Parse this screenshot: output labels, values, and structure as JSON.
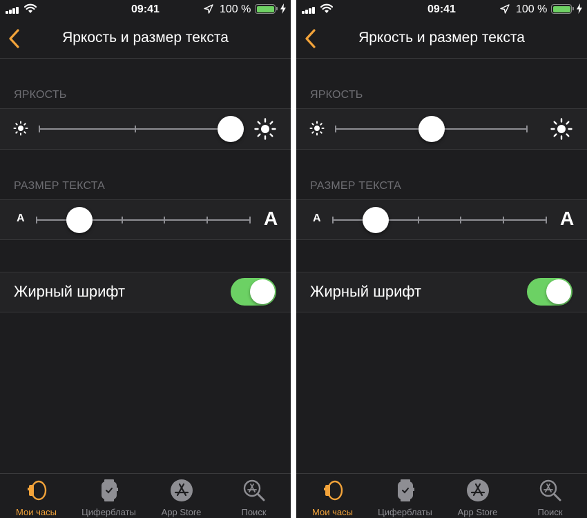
{
  "theme": {
    "accent": "#F2A33A",
    "toggle_on": "#6CD164",
    "battery_fill": "#6FD164",
    "background": "#1D1D1F",
    "cell_background": "#232325",
    "secondary_text": "#6E6E73"
  },
  "screens": [
    {
      "status_bar": {
        "time": "09:41",
        "battery_text": "100 %",
        "signal_icon": "cellular-signal-icon",
        "wifi_icon": "wifi-icon",
        "location_icon": "location-arrow-icon",
        "battery_icon": "battery-icon",
        "charging_icon": "charging-bolt-icon"
      },
      "nav": {
        "title": "Яркость и размер текста",
        "back_icon": "chevron-left-icon"
      },
      "brightness": {
        "header": "ЯРКОСТЬ",
        "value": 1.0,
        "steps": 2,
        "min_icon": "sun-small-icon",
        "max_icon": "sun-large-icon"
      },
      "text_size": {
        "header": "РАЗМЕР ТЕКСТА",
        "value_step": 1,
        "steps": 5,
        "min_label": "A",
        "max_label": "A"
      },
      "bold_text": {
        "label": "Жирный шрифт",
        "on": true
      },
      "tabs": [
        {
          "label": "Мои часы",
          "icon": "watch-icon",
          "active": true
        },
        {
          "label": "Циферблаты",
          "icon": "watch-face-icon",
          "active": false
        },
        {
          "label": "App Store",
          "icon": "app-store-icon",
          "active": false
        },
        {
          "label": "Поиск",
          "icon": "search-icon",
          "active": false
        }
      ]
    },
    {
      "status_bar": {
        "time": "09:41",
        "battery_text": "100 %",
        "signal_icon": "cellular-signal-icon",
        "wifi_icon": "wifi-icon",
        "location_icon": "location-arrow-icon",
        "battery_icon": "battery-icon",
        "charging_icon": "charging-bolt-icon"
      },
      "nav": {
        "title": "Яркость и размер текста",
        "back_icon": "chevron-left-icon"
      },
      "brightness": {
        "header": "ЯРКОСТЬ",
        "value": 0.5,
        "steps": 2,
        "min_icon": "sun-small-icon",
        "max_icon": "sun-large-icon"
      },
      "text_size": {
        "header": "РАЗМЕР ТЕКСТА",
        "value_step": 1,
        "steps": 5,
        "min_label": "A",
        "max_label": "A"
      },
      "bold_text": {
        "label": "Жирный шрифт",
        "on": true
      },
      "tabs": [
        {
          "label": "Мои часы",
          "icon": "watch-icon",
          "active": true
        },
        {
          "label": "Циферблаты",
          "icon": "watch-face-icon",
          "active": false
        },
        {
          "label": "App Store",
          "icon": "app-store-icon",
          "active": false
        },
        {
          "label": "Поиск",
          "icon": "search-icon",
          "active": false
        }
      ]
    }
  ]
}
